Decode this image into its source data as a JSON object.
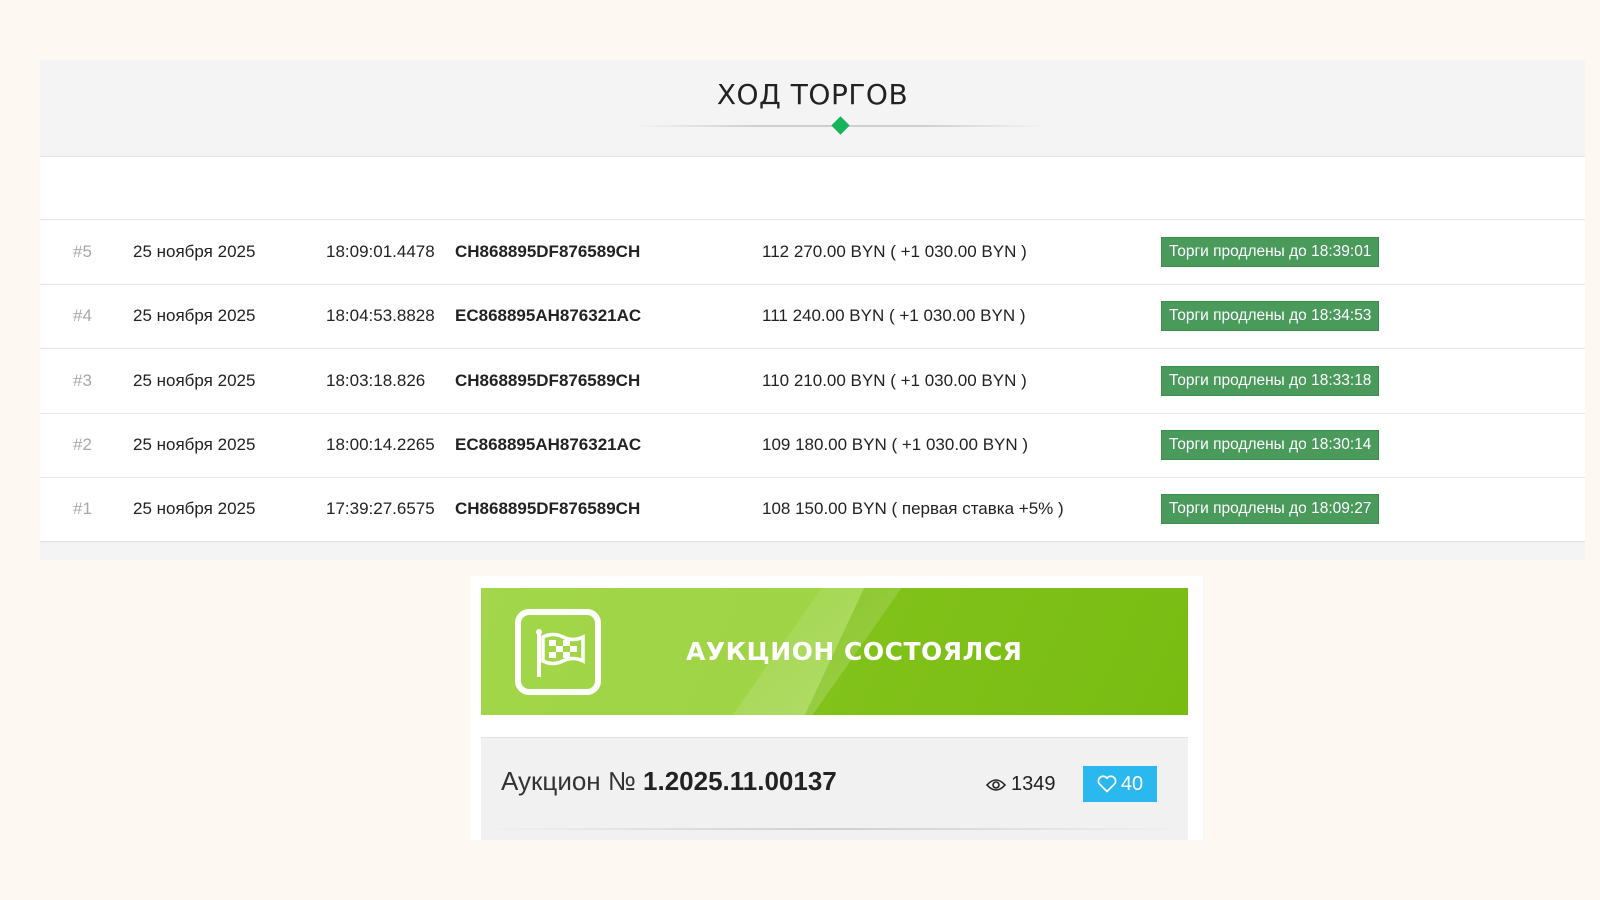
{
  "bids_panel": {
    "title": "ХОД ТОРГОВ",
    "bids": [
      {
        "num": "#5",
        "date": "25 ноября 2025",
        "time": "18:09:01.4478",
        "participant": "CH868895DF876589CH",
        "amount": "112 270.00 BYN ( +1 030.00 BYN )",
        "status": "Торги продлены до 18:39:01"
      },
      {
        "num": "#4",
        "date": "25 ноября 2025",
        "time": "18:04:53.8828",
        "participant": "EC868895AH876321AC",
        "amount": "111 240.00 BYN ( +1 030.00 BYN )",
        "status": "Торги продлены до 18:34:53"
      },
      {
        "num": "#3",
        "date": "25 ноября 2025",
        "time": "18:03:18.826",
        "participant": "CH868895DF876589CH",
        "amount": "110 210.00 BYN ( +1 030.00 BYN )",
        "status": "Торги продлены до 18:33:18"
      },
      {
        "num": "#2",
        "date": "25 ноября 2025",
        "time": "18:00:14.2265",
        "participant": "EC868895AH876321AC",
        "amount": "109 180.00 BYN ( +1 030.00 BYN )",
        "status": "Торги продлены до 18:30:14"
      },
      {
        "num": "#1",
        "date": "25 ноября 2025",
        "time": "17:39:27.6575",
        "participant": "CH868895DF876589CH",
        "amount": "108 150.00 BYN ( первая ставка +5% )",
        "status": "Торги продлены до 18:09:27"
      }
    ]
  },
  "result": {
    "banner_text": "АУКЦИОН СОСТОЯЛСЯ",
    "banner_icon": "checkered-flag-icon",
    "auction_label": "Аукцион №",
    "auction_number": "1.2025.11.00137",
    "views": "1349",
    "likes": "40"
  },
  "colors": {
    "accent_green": "#18b35a",
    "badge_green": "#4a9a5c",
    "banner_green": "#8cc63f",
    "like_blue": "#2ab8ee"
  }
}
